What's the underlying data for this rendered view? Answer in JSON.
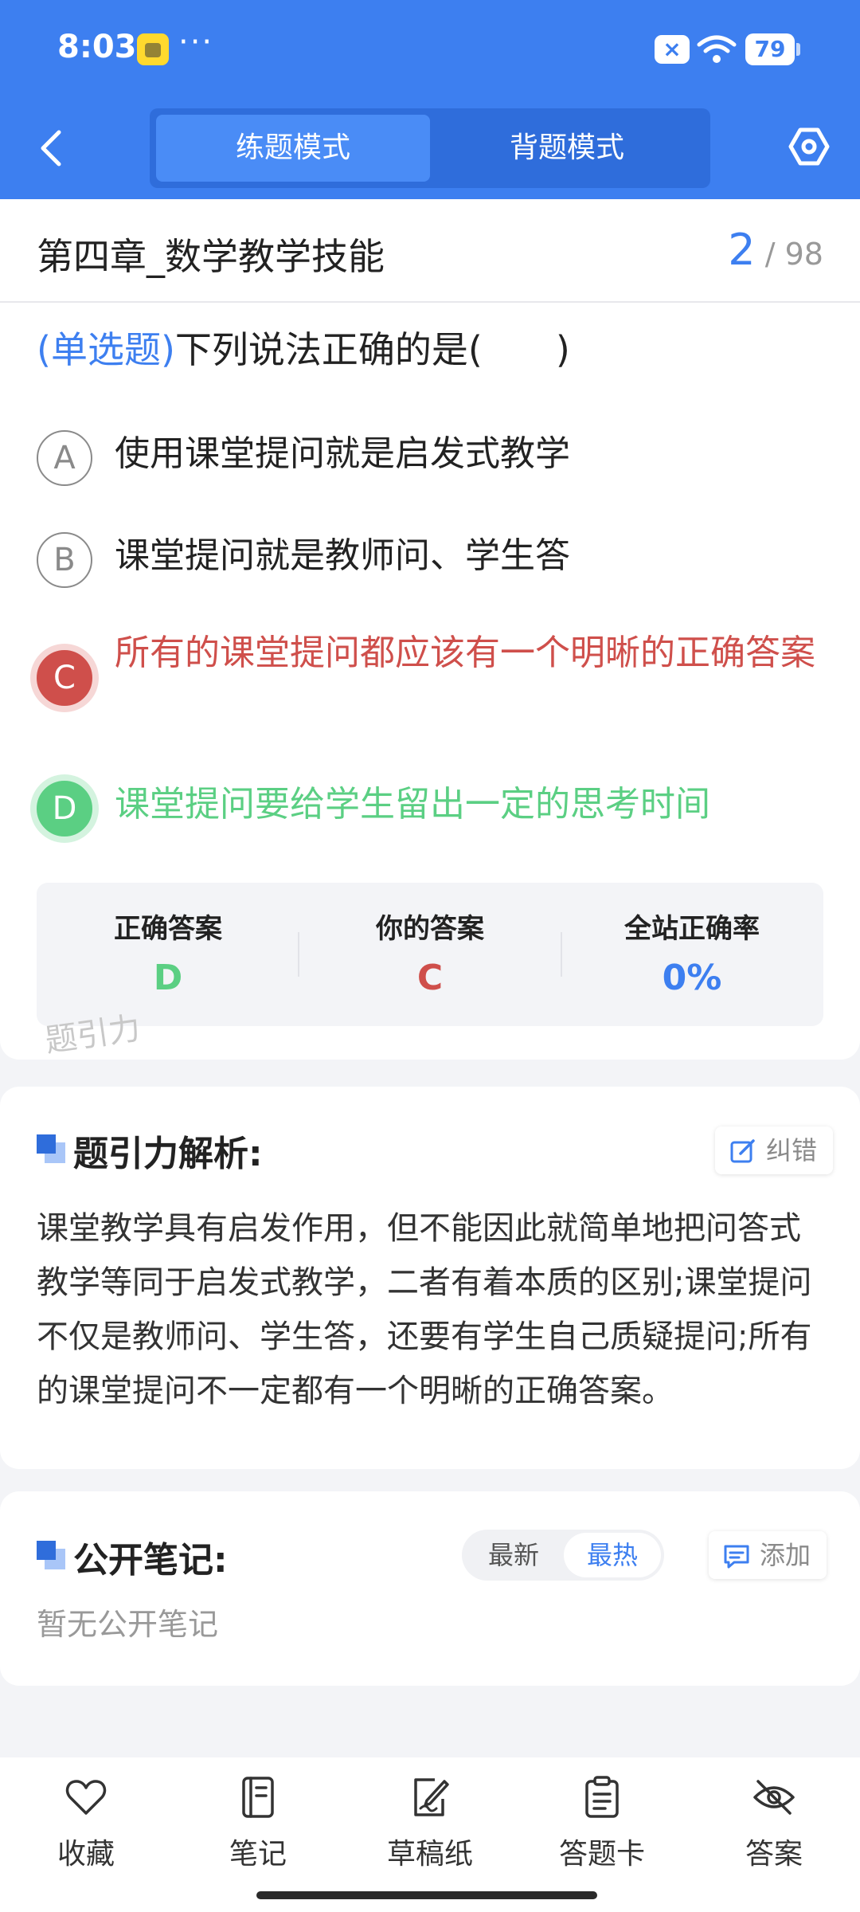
{
  "status_bar": {
    "time": "8:03",
    "more": "···",
    "sim_label": "×",
    "battery": "79"
  },
  "header": {
    "tabs": [
      {
        "label": "练题模式",
        "active": true
      },
      {
        "label": "背题模式",
        "active": false
      }
    ]
  },
  "question": {
    "chapter": "第四章_数学教学技能",
    "current": "2",
    "total": "/ 98",
    "type": "(单选题)",
    "text": "下列说法正确的是(　　)",
    "options": [
      {
        "letter": "A",
        "text": "使用课堂提问就是启发式教学",
        "state": "normal"
      },
      {
        "letter": "B",
        "text": "课堂提问就是教师问、学生答",
        "state": "normal"
      },
      {
        "letter": "C",
        "text": "所有的课堂提问都应该有一个明晰的正确答案",
        "state": "wrong"
      },
      {
        "letter": "D",
        "text": "课堂提问要给学生留出一定的思考时间",
        "state": "correct"
      }
    ],
    "stats": [
      {
        "label": "正确答案",
        "value": "D",
        "color": "#5bcf83"
      },
      {
        "label": "你的答案",
        "value": "C",
        "color": "#cf4f4b"
      },
      {
        "label": "全站正确率",
        "value": "0%",
        "color": "#3d7ff0"
      }
    ],
    "watermark": "题引力"
  },
  "analysis": {
    "title": "题引力解析:",
    "report_label": "纠错",
    "text": "课堂教学具有启发作用，但不能因此就简单地把问答式教学等同于启发式教学，二者有着本质的区别;课堂提问不仅是教师问、学生答，还要有学生自己质疑提问;所有的课堂提问不一定都有一个明晰的正确答案。"
  },
  "notes": {
    "title": "公开笔记:",
    "sort_options": [
      "最新",
      "最热"
    ],
    "sort_selected": "最热",
    "add_label": "添加",
    "empty_text": "暂无公开笔记"
  },
  "bottom_nav": [
    {
      "label": "收藏",
      "icon": "heart-icon"
    },
    {
      "label": "笔记",
      "icon": "notebook-icon"
    },
    {
      "label": "草稿纸",
      "icon": "draft-pen-icon"
    },
    {
      "label": "答题卡",
      "icon": "clipboard-icon"
    },
    {
      "label": "答案",
      "icon": "eye-off-icon"
    }
  ],
  "colors": {
    "primary": "#3d7ff0",
    "wrong": "#cf4f4b",
    "correct": "#5bcf83"
  }
}
